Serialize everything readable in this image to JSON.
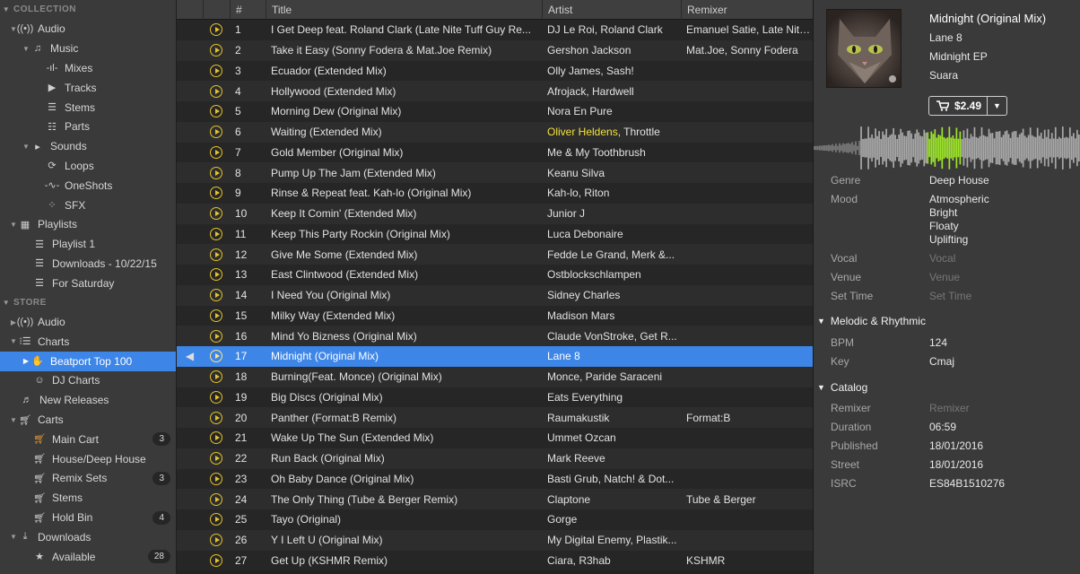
{
  "sidebar": {
    "collection_label": "COLLECTION",
    "store_label": "STORE",
    "items": [
      {
        "label": "Audio",
        "icon": "radio-icon"
      },
      {
        "label": "Music",
        "icon": "music-note-icon"
      },
      {
        "label": "Mixes",
        "icon": "mixes-icon"
      },
      {
        "label": "Tracks",
        "icon": "play-circle-icon"
      },
      {
        "label": "Stems",
        "icon": "stems-icon"
      },
      {
        "label": "Parts",
        "icon": "parts-icon"
      },
      {
        "label": "Sounds",
        "icon": "sounds-icon"
      },
      {
        "label": "Loops",
        "icon": "loop-icon"
      },
      {
        "label": "OneShots",
        "icon": "oneshot-icon"
      },
      {
        "label": "SFX",
        "icon": "sfx-icon"
      },
      {
        "label": "Playlists",
        "icon": "playlists-icon"
      },
      {
        "label": "Playlist 1",
        "icon": "list-icon"
      },
      {
        "label": "Downloads - 10/22/15",
        "icon": "list-icon"
      },
      {
        "label": "For Saturday",
        "icon": "list-icon"
      }
    ],
    "store_items": [
      {
        "label": "Audio",
        "icon": "radio-icon"
      },
      {
        "label": "Charts",
        "icon": "charts-icon"
      },
      {
        "label": "Beatport Top 100",
        "icon": "beatport-icon"
      },
      {
        "label": "DJ Charts",
        "icon": "dj-icon"
      },
      {
        "label": "New Releases",
        "icon": "new-releases-icon"
      },
      {
        "label": "Carts",
        "icon": "cart-icon"
      },
      {
        "label": "Main Cart",
        "icon": "cart-icon",
        "badge": "3"
      },
      {
        "label": "House/Deep House",
        "icon": "cart-icon"
      },
      {
        "label": "Remix Sets",
        "icon": "cart-icon",
        "badge": "3"
      },
      {
        "label": "Stems",
        "icon": "cart-icon"
      },
      {
        "label": "Hold Bin",
        "icon": "cart-icon",
        "badge": "4"
      },
      {
        "label": "Downloads",
        "icon": "download-icon"
      },
      {
        "label": "Available",
        "icon": "star-icon",
        "badge": "28"
      }
    ]
  },
  "table": {
    "columns": [
      "#",
      "Title",
      "Artist",
      "Remixer"
    ],
    "rows": [
      {
        "n": "1",
        "title": "I Get Deep feat. Roland Clark (Late Nite Tuff Guy Re...",
        "artist": "DJ Le Roi, Roland Clark",
        "remixer": "Emanuel Satie, Late Nite..."
      },
      {
        "n": "2",
        "title": "Take it Easy (Sonny Fodera & Mat.Joe Remix)",
        "artist": "Gershon Jackson",
        "remixer": "Mat.Joe, Sonny Fodera"
      },
      {
        "n": "3",
        "title": "Ecuador (Extended Mix)",
        "artist": "Olly James, Sash!",
        "remixer": ""
      },
      {
        "n": "4",
        "title": "Hollywood (Extended Mix)",
        "artist": "Afrojack, Hardwell",
        "remixer": ""
      },
      {
        "n": "5",
        "title": "Morning Dew (Original Mix)",
        "artist": "Nora En Pure",
        "remixer": ""
      },
      {
        "n": "6",
        "title": "Waiting (Extended Mix)",
        "artist_hl": "Oliver Heldens",
        "artist_rest": ", Throttle",
        "remixer": ""
      },
      {
        "n": "7",
        "title": "Gold Member (Original Mix)",
        "artist": "Me & My Toothbrush",
        "remixer": ""
      },
      {
        "n": "8",
        "title": "Pump Up The Jam (Extended Mix)",
        "artist": "Keanu Silva",
        "remixer": ""
      },
      {
        "n": "9",
        "title": "Rinse & Repeat feat. Kah-lo (Original Mix)",
        "artist": "Kah-lo, Riton",
        "remixer": ""
      },
      {
        "n": "10",
        "title": "Keep It Comin' (Extended Mix)",
        "artist": "Junior J",
        "remixer": ""
      },
      {
        "n": "11",
        "title": "Keep This Party Rockin (Original Mix)",
        "artist": "Luca Debonaire",
        "remixer": ""
      },
      {
        "n": "12",
        "title": "Give Me Some (Extended Mix)",
        "artist": "Fedde Le Grand, Merk &...",
        "remixer": ""
      },
      {
        "n": "13",
        "title": "East Clintwood (Extended Mix)",
        "artist": "Ostblockschlampen",
        "remixer": ""
      },
      {
        "n": "14",
        "title": "I Need You (Original Mix)",
        "artist": "Sidney Charles",
        "remixer": ""
      },
      {
        "n": "15",
        "title": "Milky Way (Extended Mix)",
        "artist": "Madison Mars",
        "remixer": ""
      },
      {
        "n": "16",
        "title": "Mind Yo Bizness (Original Mix)",
        "artist": "Claude VonStroke, Get R...",
        "remixer": ""
      },
      {
        "n": "17",
        "title": "Midnight (Original Mix)",
        "artist": "Lane 8",
        "remixer": "",
        "selected": true
      },
      {
        "n": "18",
        "title": "Burning(Feat. Monce) (Original Mix)",
        "artist": "Monce, Paride Saraceni",
        "remixer": ""
      },
      {
        "n": "19",
        "title": "Big Discs (Original Mix)",
        "artist": "Eats Everything",
        "remixer": ""
      },
      {
        "n": "20",
        "title": "Panther (Format:B Remix)",
        "artist": "Raumakustik",
        "remixer": "Format:B"
      },
      {
        "n": "21",
        "title": "Wake Up The Sun (Extended Mix)",
        "artist": "Ummet Ozcan",
        "remixer": ""
      },
      {
        "n": "22",
        "title": "Run Back (Original Mix)",
        "artist": "Mark Reeve",
        "remixer": ""
      },
      {
        "n": "23",
        "title": "Oh Baby Dance (Original Mix)",
        "artist": "Basti Grub, Natch! & Dot...",
        "remixer": ""
      },
      {
        "n": "24",
        "title": "The Only Thing (Tube & Berger Remix)",
        "artist": "Claptone",
        "remixer": "Tube & Berger"
      },
      {
        "n": "25",
        "title": "Tayo (Original)",
        "artist": "Gorge",
        "remixer": ""
      },
      {
        "n": "26",
        "title": "Y I Left U (Original Mix)",
        "artist": "My Digital Enemy, Plastik...",
        "remixer": ""
      },
      {
        "n": "27",
        "title": "Get Up (KSHMR Remix)",
        "artist": "Ciara, R3hab",
        "remixer": "KSHMR"
      }
    ]
  },
  "detail": {
    "title": "Midnight (Original Mix)",
    "artist": "Lane 8",
    "release": "Midnight EP",
    "label": "Suara",
    "price": "$2.49",
    "progress": 0.42,
    "genre_k": "Genre",
    "genre": "Deep House",
    "mood_k": "Mood",
    "mood": [
      "Atmospheric",
      "Bright",
      "Floaty",
      "Uplifting"
    ],
    "vocal_k": "Vocal",
    "vocal": "Vocal",
    "venue_k": "Venue",
    "venue": "Venue",
    "settime_k": "Set Time",
    "settime": "Set Time",
    "melodic_header": "Melodic & Rhythmic",
    "bpm_k": "BPM",
    "bpm": "124",
    "key_k": "Key",
    "key": "Cmaj",
    "catalog_header": "Catalog",
    "remixer_k": "Remixer",
    "remixer": "Remixer",
    "duration_k": "Duration",
    "duration": "06:59",
    "published_k": "Published",
    "published": "18/01/2016",
    "street_k": "Street",
    "street": "18/01/2016",
    "isrc_k": "ISRC",
    "isrc": "ES84B1510276"
  },
  "colors": {
    "accent": "#3d86e8",
    "play": "#e3c22a",
    "wave_played": "#9ee62a",
    "highlight": "#f3e23c"
  }
}
